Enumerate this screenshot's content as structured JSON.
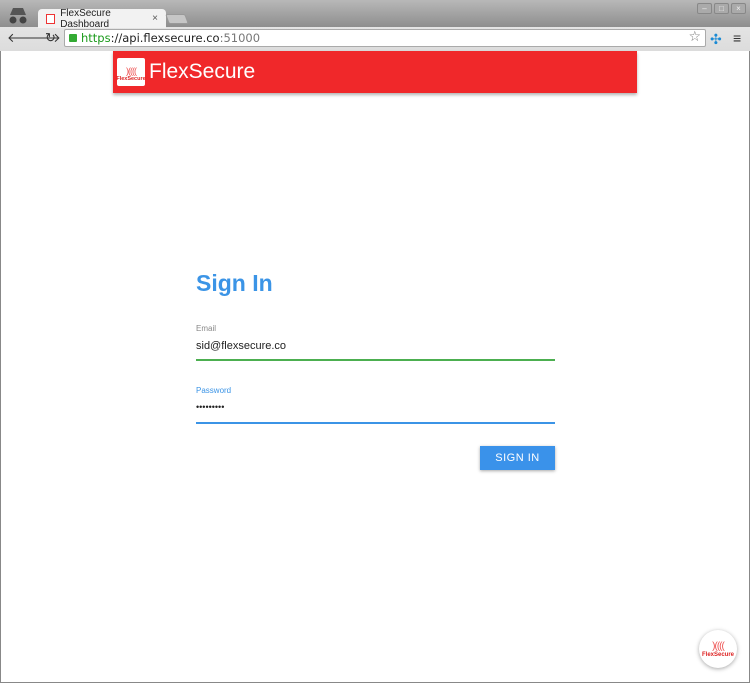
{
  "browser": {
    "tab_title": "FlexSecure Dashboard",
    "tab_close": "×",
    "url_scheme": "https",
    "url_sep": "://",
    "url_host": "api.flexsecure.co",
    "url_port": ":51000",
    "icons": [
      "incognito-icon",
      "back-icon",
      "forward-icon",
      "reload-icon",
      "lock-icon",
      "star-icon",
      "extension-icon",
      "menu-icon"
    ]
  },
  "header": {
    "brand": "FlexSecure",
    "logo_text": "FlexSecure"
  },
  "form": {
    "title": "Sign In",
    "email_label": "Email",
    "email_value": "sid@flexsecure.co",
    "password_label": "Password",
    "password_value": "•••••••••",
    "submit": "SIGN IN"
  },
  "fab": {
    "logo_text": "FlexSecure"
  },
  "colors": {
    "brand_red": "#f0282a",
    "accent_blue": "#3b94e6",
    "valid_green": "#4caf50"
  }
}
